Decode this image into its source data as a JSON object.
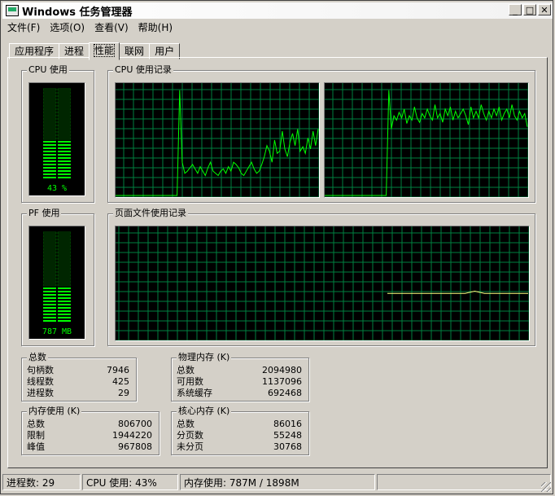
{
  "window": {
    "title": "Windows 任务管理器"
  },
  "controls": {
    "minimize": "_",
    "maximize": "□",
    "close": "✕"
  },
  "menu": [
    "文件(F)",
    "选项(O)",
    "查看(V)",
    "帮助(H)"
  ],
  "tabs": [
    "应用程序",
    "进程",
    "性能",
    "联网",
    "用户"
  ],
  "active_tab": 2,
  "performance": {
    "cpu_usage": {
      "label": "CPU 使用",
      "value_text": "43 %",
      "fraction": 0.43
    },
    "cpu_history": {
      "label": "CPU 使用记录",
      "cores": [
        {
          "values": [
            0,
            0,
            0,
            0,
            0,
            0,
            0,
            0,
            0,
            0,
            0,
            0,
            0,
            0,
            0,
            0,
            0,
            0,
            0,
            0,
            0,
            0,
            0,
            0,
            0,
            95,
            30,
            20,
            22,
            25,
            28,
            24,
            20,
            26,
            22,
            18,
            25,
            30,
            22,
            20,
            18,
            22,
            24,
            20,
            26,
            22,
            30,
            28,
            25,
            20,
            18,
            22,
            26,
            30,
            24,
            20,
            22,
            28,
            35,
            45,
            40,
            30,
            50,
            38,
            40,
            58,
            42,
            35,
            48,
            56,
            45,
            60,
            40,
            44,
            38,
            52,
            42,
            58,
            45,
            60
          ]
        },
        {
          "values": [
            0,
            0,
            0,
            0,
            0,
            0,
            0,
            0,
            0,
            0,
            0,
            0,
            0,
            0,
            0,
            0,
            0,
            0,
            0,
            0,
            0,
            0,
            0,
            0,
            0,
            95,
            60,
            72,
            68,
            75,
            70,
            78,
            65,
            72,
            68,
            80,
            70,
            66,
            74,
            70,
            78,
            72,
            68,
            82,
            70,
            74,
            66,
            78,
            72,
            80,
            68,
            76,
            70,
            74,
            78,
            72,
            64,
            80,
            70,
            76,
            70,
            82,
            74,
            68,
            76,
            70,
            78,
            72,
            80,
            68,
            74,
            78,
            70,
            82,
            72,
            68,
            76,
            70,
            74,
            62
          ]
        }
      ]
    },
    "pf_usage": {
      "label": "PF 使用",
      "value_text": "787 MB",
      "fraction": 0.41
    },
    "pf_history": {
      "label": "页面文件使用记录",
      "values": [
        null,
        null,
        null,
        null,
        null,
        null,
        null,
        null,
        null,
        null,
        null,
        null,
        null,
        null,
        null,
        null,
        null,
        null,
        null,
        null,
        null,
        null,
        null,
        null,
        null,
        null,
        null,
        null,
        null,
        null,
        null,
        null,
        null,
        null,
        null,
        null,
        null,
        null,
        null,
        null,
        null,
        null,
        null,
        null,
        null,
        null,
        null,
        null,
        null,
        null,
        null,
        null,
        null,
        null,
        null,
        null,
        41,
        41,
        41,
        41,
        41,
        41,
        41,
        41,
        41,
        41,
        41,
        41,
        41,
        41,
        41,
        41,
        41,
        42,
        43,
        42,
        41,
        41,
        41,
        41,
        41,
        41,
        41,
        41,
        41,
        41
      ]
    },
    "totals": {
      "label": "总数",
      "rows": [
        {
          "name": "句柄数",
          "value": "7946"
        },
        {
          "name": "线程数",
          "value": "425"
        },
        {
          "name": "进程数",
          "value": "29"
        }
      ]
    },
    "physical_memory": {
      "label": "物理内存 (K)",
      "rows": [
        {
          "name": "总数",
          "value": "2094980"
        },
        {
          "name": "可用数",
          "value": "1137096"
        },
        {
          "name": "系统缓存",
          "value": "692468"
        }
      ]
    },
    "commit_charge": {
      "label": "内存使用 (K)",
      "rows": [
        {
          "name": "总数",
          "value": "806700"
        },
        {
          "name": "限制",
          "value": "1944220"
        },
        {
          "name": "峰值",
          "value": "967808"
        }
      ]
    },
    "kernel_memory": {
      "label": "核心内存 (K)",
      "rows": [
        {
          "name": "总数",
          "value": "86016"
        },
        {
          "name": "分页数",
          "value": "55248"
        },
        {
          "name": "未分页",
          "value": "30768"
        }
      ]
    }
  },
  "status": {
    "processes": "进程数: 29",
    "cpu": "CPU 使用: 43%",
    "memory": "内存使用: 787M / 1898M"
  },
  "colors": {
    "grid": "#008040",
    "trace": "#00ff00",
    "pf_trace": "#ffff80",
    "meter_on": "#00ff00",
    "meter_off": "#007f00"
  }
}
